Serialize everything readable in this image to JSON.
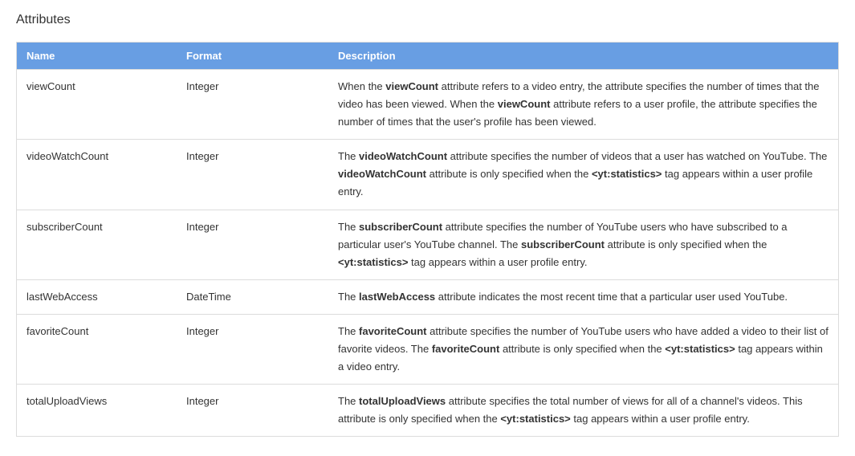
{
  "section_title": "Attributes",
  "table": {
    "headers": {
      "name": "Name",
      "format": "Format",
      "description": "Description"
    },
    "rows": [
      {
        "name": "viewCount",
        "format": "Integer",
        "description_parts": [
          {
            "t": "text",
            "v": "When the "
          },
          {
            "t": "bold",
            "v": "viewCount"
          },
          {
            "t": "text",
            "v": " attribute refers to a video entry, the attribute specifies the number of times that the video has been viewed. When the "
          },
          {
            "t": "bold",
            "v": "viewCount"
          },
          {
            "t": "text",
            "v": " attribute refers to a user profile, the attribute specifies the number of times that the user's profile has been viewed."
          }
        ]
      },
      {
        "name": "videoWatchCount",
        "format": "Integer",
        "description_parts": [
          {
            "t": "text",
            "v": "The "
          },
          {
            "t": "bold",
            "v": "videoWatchCount"
          },
          {
            "t": "text",
            "v": " attribute specifies the number of videos that a user has watched on YouTube. The "
          },
          {
            "t": "bold",
            "v": "videoWatchCount"
          },
          {
            "t": "text",
            "v": " attribute is only specified when the "
          },
          {
            "t": "bold",
            "v": "<yt:statistics>"
          },
          {
            "t": "text",
            "v": " tag appears within a user profile entry."
          }
        ]
      },
      {
        "name": "subscriberCount",
        "format": "Integer",
        "description_parts": [
          {
            "t": "text",
            "v": "The "
          },
          {
            "t": "bold",
            "v": "subscriberCount"
          },
          {
            "t": "text",
            "v": " attribute specifies the number of YouTube users who have subscribed to a particular user's YouTube channel. The "
          },
          {
            "t": "bold",
            "v": "subscriberCount"
          },
          {
            "t": "text",
            "v": " attribute is only specified when the "
          },
          {
            "t": "bold",
            "v": "<yt:statistics>"
          },
          {
            "t": "text",
            "v": " tag appears within a user profile entry."
          }
        ]
      },
      {
        "name": "lastWebAccess",
        "format": "DateTime",
        "description_parts": [
          {
            "t": "text",
            "v": "The "
          },
          {
            "t": "bold",
            "v": "lastWebAccess"
          },
          {
            "t": "text",
            "v": " attribute indicates the most recent time that a particular user used YouTube."
          }
        ]
      },
      {
        "name": "favoriteCount",
        "format": "Integer",
        "description_parts": [
          {
            "t": "text",
            "v": "The "
          },
          {
            "t": "bold",
            "v": "favoriteCount"
          },
          {
            "t": "text",
            "v": " attribute specifies the number of YouTube users who have added a video to their list of favorite videos. The "
          },
          {
            "t": "bold",
            "v": "favoriteCount"
          },
          {
            "t": "text",
            "v": " attribute is only specified when the "
          },
          {
            "t": "bold",
            "v": "<yt:statistics>"
          },
          {
            "t": "text",
            "v": " tag appears within a video entry."
          }
        ]
      },
      {
        "name": "totalUploadViews",
        "format": "Integer",
        "description_parts": [
          {
            "t": "text",
            "v": "The "
          },
          {
            "t": "bold",
            "v": "totalUploadViews"
          },
          {
            "t": "text",
            "v": " attribute specifies the total number of views for all of a channel's videos. This attribute is only specified when the "
          },
          {
            "t": "bold",
            "v": "<yt:statistics>"
          },
          {
            "t": "text",
            "v": " tag appears within a user profile entry."
          }
        ]
      }
    ]
  }
}
